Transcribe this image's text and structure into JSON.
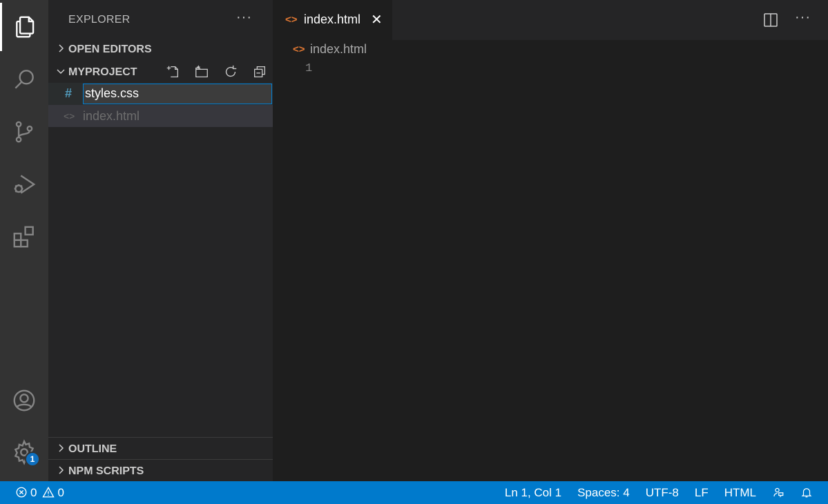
{
  "activity_bar": {
    "items": [
      "explorer-icon",
      "search-icon",
      "source-control-icon",
      "run-debug-icon",
      "extensions-icon"
    ],
    "bottom": [
      "account-icon",
      "settings-gear-icon"
    ],
    "settings_badge": "1"
  },
  "sidebar": {
    "title": "EXPLORER",
    "more": "···",
    "sections": {
      "open_editors": "OPEN EDITORS",
      "project": "MYPROJECT",
      "outline": "OUTLINE",
      "npm_scripts": "NPM SCRIPTS"
    },
    "tree": {
      "editing_icon": "#",
      "editing_value": "styles.css",
      "file_icon": "<>",
      "file_name": "index.html"
    }
  },
  "editor": {
    "tab": {
      "icon": "<>",
      "label": "index.html",
      "close": "✕"
    },
    "more": "···",
    "breadcrumb": {
      "icon": "<>",
      "label": "index.html"
    },
    "line_numbers": [
      "1"
    ]
  },
  "statusbar": {
    "errors": "0",
    "warnings": "0",
    "position": "Ln 1, Col 1",
    "spaces": "Spaces: 4",
    "encoding": "UTF-8",
    "eol": "LF",
    "language": "HTML"
  },
  "colors": {
    "accent": "#007acc",
    "html_icon": "#e37933",
    "css_icon": "#519aba"
  }
}
